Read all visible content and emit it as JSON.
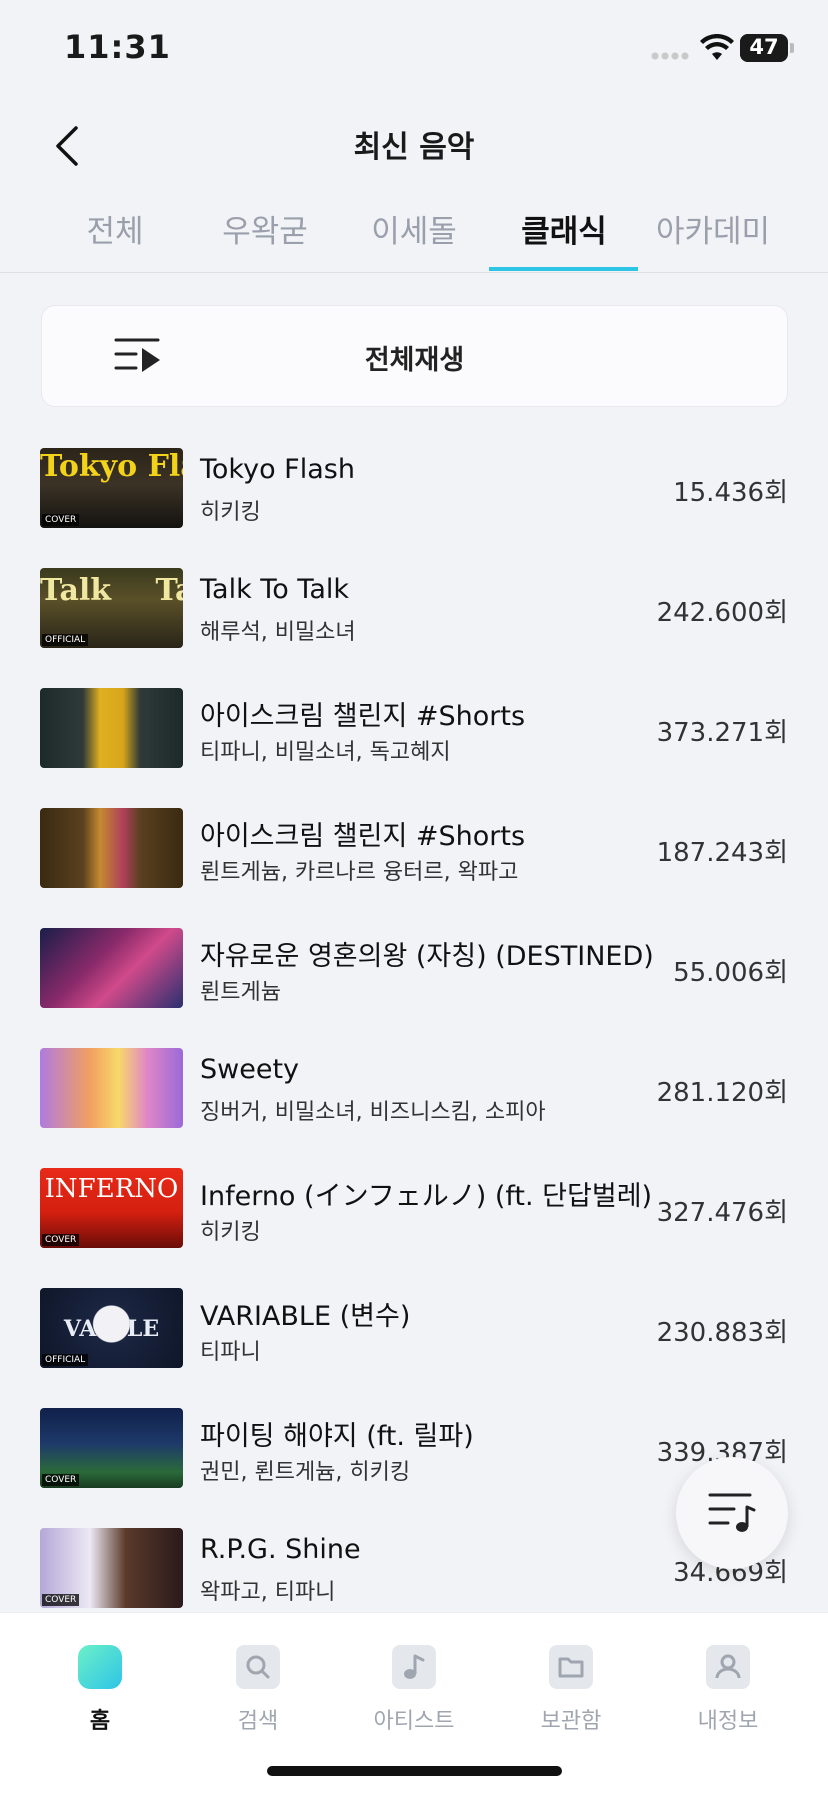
{
  "status": {
    "time": "11:31",
    "battery": "47"
  },
  "header": {
    "title": "최신 음악"
  },
  "tabs": [
    {
      "label": "전체"
    },
    {
      "label": "우왁굳"
    },
    {
      "label": "이세돌"
    },
    {
      "label": "클래식"
    },
    {
      "label": "아카데미"
    }
  ],
  "active_tab": "클래식",
  "play_all": {
    "label": "전체재생"
  },
  "tracks": [
    {
      "title": "Tokyo Flash",
      "artist": "히키킹",
      "plays": "15.436회",
      "thumb_text": "Tokyo Flash",
      "thumb_badge": "COVER"
    },
    {
      "title": "Talk To Talk",
      "artist": "해루석, 비밀소녀",
      "plays": "242.600회",
      "thumb_text": "Talk Talk",
      "thumb_badge": "OFFICIAL"
    },
    {
      "title": "아이스크림 챌린지 #Shorts",
      "artist": "티파니, 비밀소녀, 독고혜지",
      "plays": "373.271회",
      "thumb_text": "",
      "thumb_badge": ""
    },
    {
      "title": "아이스크림 챌린지 #Shorts",
      "artist": "뢴트게늄, 카르나르 융터르, 왁파고",
      "plays": "187.243회",
      "thumb_text": "",
      "thumb_badge": ""
    },
    {
      "title": "자유로운 영혼의왕 (자칭) (DESTINED)",
      "artist": "뢴트게늄",
      "plays": "55.006회",
      "thumb_text": "",
      "thumb_badge": ""
    },
    {
      "title": "Sweety",
      "artist": "징버거, 비밀소녀, 비즈니스킴, 소피아",
      "plays": "281.120회",
      "thumb_text": "",
      "thumb_badge": ""
    },
    {
      "title": "Inferno (インフェルノ) (ft. 단답벌레)",
      "artist": "히키킹",
      "plays": "327.476회",
      "thumb_text": "INFERNO",
      "thumb_badge": "COVER"
    },
    {
      "title": "VARIABLE (변수)",
      "artist": "티파니",
      "plays": "230.883회",
      "thumb_text": "VA    LE",
      "thumb_badge": "OFFICIAL"
    },
    {
      "title": "파이팅 해야지 (ft. 릴파)",
      "artist": "권민, 뢴트게늄, 히키킹",
      "plays": "339.387회",
      "thumb_text": "",
      "thumb_badge": "COVER"
    },
    {
      "title": "R.P.G. Shine",
      "artist": "왁파고, 티파니",
      "plays": "34.669회",
      "thumb_text": "",
      "thumb_badge": "COVER"
    }
  ],
  "nav": [
    {
      "label": "홈",
      "icon": "home-icon"
    },
    {
      "label": "검색",
      "icon": "search-icon"
    },
    {
      "label": "아티스트",
      "icon": "artist-icon"
    },
    {
      "label": "보관함",
      "icon": "folder-icon"
    },
    {
      "label": "내정보",
      "icon": "profile-icon"
    }
  ],
  "colors": {
    "accent": "#2ec4e6",
    "background": "#f2f3f7",
    "muted": "#9aa0ab"
  }
}
